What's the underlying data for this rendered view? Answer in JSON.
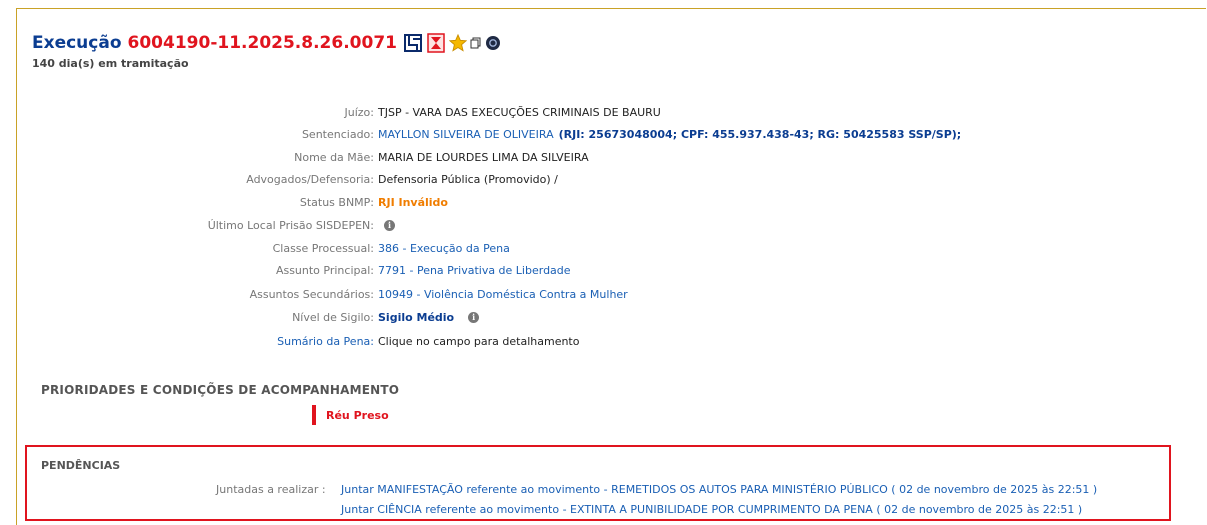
{
  "header": {
    "label": "Execução",
    "process_number": "6004190-11.2025.8.26.0071",
    "subtitle": "140 dia(s) em tramitação",
    "icons": [
      "hierarchy-icon",
      "hourglass-icon",
      "star-icon",
      "copy-icon",
      "circle-info-icon"
    ]
  },
  "details": {
    "juizo": {
      "label": "Juízo:",
      "value": "TJSP - VARA DAS EXECUÇÕES CRIMINAIS DE BAURU"
    },
    "sentenciado": {
      "label": "Sentenciado:",
      "name": "MAYLLON SILVEIRA DE OLIVEIRA",
      "docs": "(RJI: 25673048004; CPF: 455.937.438-43; RG: 50425583 SSP/SP);"
    },
    "mae": {
      "label": "Nome da Mãe:",
      "value": "MARIA DE LOURDES LIMA DA SILVEIRA"
    },
    "advogados": {
      "label": "Advogados/Defensoria:",
      "value": "Defensoria Pública (Promovido) /"
    },
    "status_bnmp": {
      "label": "Status BNMP:",
      "value": "RJI Inválido"
    },
    "ultimo_local": {
      "label": "Último Local Prisão SISDEPEN:"
    },
    "classe": {
      "label": "Classe Processual:",
      "value": "386 - Execução da Pena"
    },
    "assunto_principal": {
      "label": "Assunto Principal:",
      "value": "7791 - Pena Privativa de Liberdade"
    },
    "assuntos_secundarios": {
      "label": "Assuntos Secundários:",
      "value": "10949 - Violência Doméstica Contra a Mulher"
    },
    "sigilo": {
      "label": "Nível de Sigilo:",
      "value": "Sigilo Médio"
    },
    "sumario": {
      "label": "Sumário da Pena:",
      "value": "Clique no campo para detalhamento"
    }
  },
  "prioridades": {
    "title": "PRIORIDADES E CONDIÇÕES DE ACOMPANHAMENTO",
    "tag": "Réu Preso"
  },
  "pendencias": {
    "title": "PENDÊNCIAS",
    "juntadas_label": "Juntadas a realizar :",
    "items": [
      "Juntar MANIFESTAÇÃO referente ao movimento - REMETIDOS OS AUTOS PARA MINISTÉRIO PÚBLICO ( 02 de novembro de 2025 às 22:51 )",
      "Juntar CIÊNCIA referente ao movimento - EXTINTA A PUNIBILIDADE POR CUMPRIMENTO DA PENA ( 02 de novembro de 2025 às 22:51 )"
    ]
  },
  "colors": {
    "accent_red": "#e0141e",
    "link_blue": "#1a5fb4",
    "title_blue": "#0b3d91",
    "warning_orange": "#f07d00",
    "frame_gold": "#c9a227"
  }
}
